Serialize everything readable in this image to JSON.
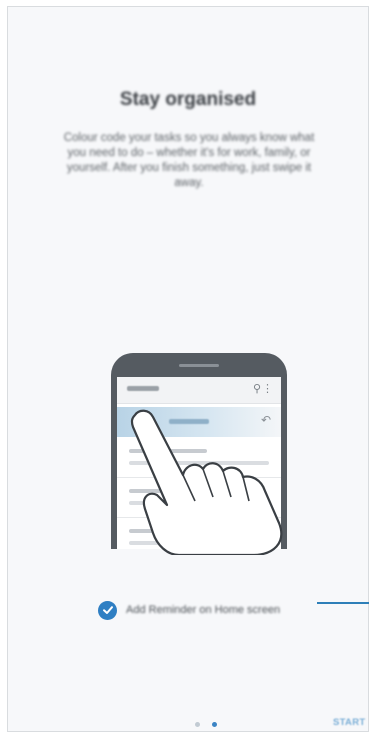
{
  "onboarding": {
    "title": "Stay organised",
    "description": "Colour code your tasks so you always know what you need to do – whether it's for work, family, or yourself. After you finish something, just swipe it away.",
    "checkbox": {
      "label": "Add Reminder on Home screen",
      "checked": true,
      "accent_color": "#2f7fc3"
    },
    "pager": {
      "total": 2,
      "current": 2
    },
    "start_label": "START"
  },
  "illustration": {
    "icons": [
      "search-icon",
      "more-options-icon",
      "undo-icon",
      "hand-icon"
    ]
  }
}
